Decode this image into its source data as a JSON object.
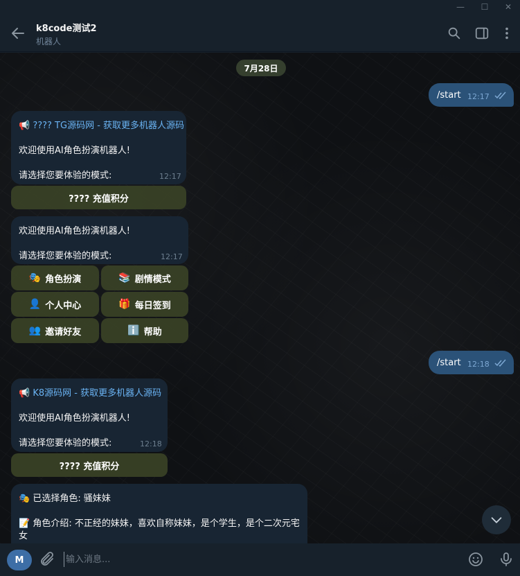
{
  "window": {
    "minimize_glyph": "—",
    "maximize_glyph": "☐",
    "close_glyph": "✕"
  },
  "header": {
    "title": "k8code测试2",
    "subtitle": "机器人"
  },
  "chat": {
    "date_label": "7月28日",
    "out1": {
      "text": "/start",
      "time": "12:17"
    },
    "msg1": {
      "link": "📢 ???? TG源码网 - 获取更多机器人源码",
      "line1": "欢迎使用AI角色扮演机器人!",
      "line2": "请选择您要体验的模式:",
      "time": "12:17",
      "button": "???? 充值积分"
    },
    "msg2": {
      "line1": "欢迎使用AI角色扮演机器人!",
      "line2": "请选择您要体验的模式:",
      "time": "12:17",
      "buttons": [
        {
          "emoji": "🎭",
          "label": "角色扮演"
        },
        {
          "emoji": "📚",
          "label": "剧情模式"
        },
        {
          "emoji": "👤",
          "label": "个人中心"
        },
        {
          "emoji": "🎁",
          "label": "每日签到"
        },
        {
          "emoji": "👥",
          "label": "邀请好友"
        },
        {
          "emoji": "ℹ️",
          "label": "帮助"
        }
      ]
    },
    "out2": {
      "text": "/start",
      "time": "12:18"
    },
    "msg3": {
      "link": "📢 K8源码网 - 获取更多机器人源码",
      "line1": "欢迎使用AI角色扮演机器人!",
      "line2": "请选择您要体验的模式:",
      "time": "12:18",
      "button": "???? 充值积分"
    },
    "msg4": {
      "line1": "🎭 已选择角色: 骚妹妹",
      "line2": "📝 角色介绍: 不正经的妹妹，喜欢自称妹妹，是个学生，是个二次元宅",
      "line3": "女"
    }
  },
  "composer": {
    "avatar_letter": "M",
    "placeholder": "输入消息...",
    "icons": [
      "attach-icon",
      "emoji-icon",
      "microphone-icon"
    ]
  },
  "colors": {
    "header_bg": "#17212b",
    "incoming_bubble": "#182533",
    "outgoing_bubble": "#2b5278",
    "keyboard_button": "#3a4226",
    "link": "#6ab3f3"
  }
}
